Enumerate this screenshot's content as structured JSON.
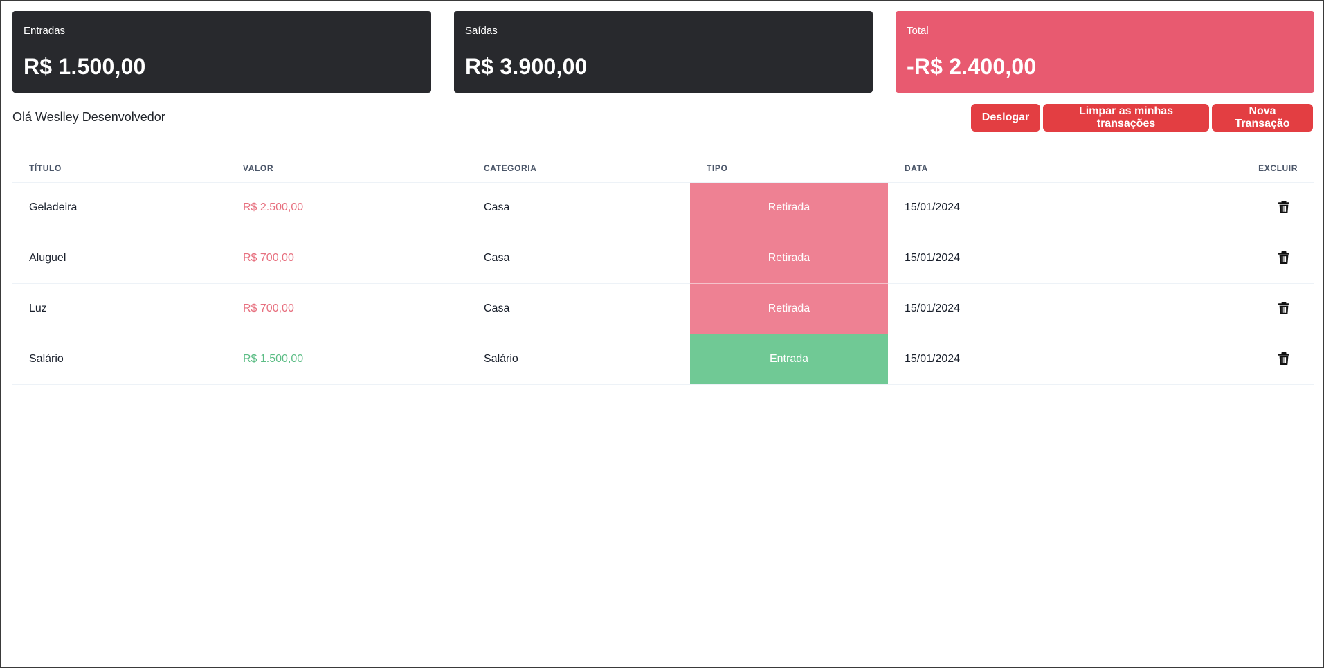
{
  "summary": {
    "income": {
      "label": "Entradas",
      "value": "R$ 1.500,00"
    },
    "expenses": {
      "label": "Saídas",
      "value": "R$ 3.900,00"
    },
    "total": {
      "label": "Total",
      "value": "-R$ 2.400,00"
    }
  },
  "greeting": "Olá Weslley Desenvolvedor",
  "actions": {
    "logout": "Deslogar",
    "clear": "Limpar as minhas transações",
    "new": "Nova Transação"
  },
  "table": {
    "headers": {
      "title": "Título",
      "value": "Valor",
      "category": "Categoria",
      "type": "Tipo",
      "date": "Data",
      "delete": "Excluir"
    },
    "rows": [
      {
        "title": "Geladeira",
        "value": "R$ 2.500,00",
        "category": "Casa",
        "type": "Retirada",
        "date": "15/01/2024"
      },
      {
        "title": "Aluguel",
        "value": "R$ 700,00",
        "category": "Casa",
        "type": "Retirada",
        "date": "15/01/2024"
      },
      {
        "title": "Luz",
        "value": "R$ 700,00",
        "category": "Casa",
        "type": "Retirada",
        "date": "15/01/2024"
      },
      {
        "title": "Salário",
        "value": "R$ 1.500,00",
        "category": "Salário",
        "type": "Entrada",
        "date": "15/01/2024"
      }
    ],
    "delete_icon": "trash-icon"
  },
  "colors": {
    "card_dark": "#28292d",
    "card_total": "#e85a70",
    "button": "#e33e42",
    "type_out": "#ee8193",
    "type_in": "#70c995",
    "value_out": "#e7707f",
    "value_in": "#5cbd85"
  }
}
